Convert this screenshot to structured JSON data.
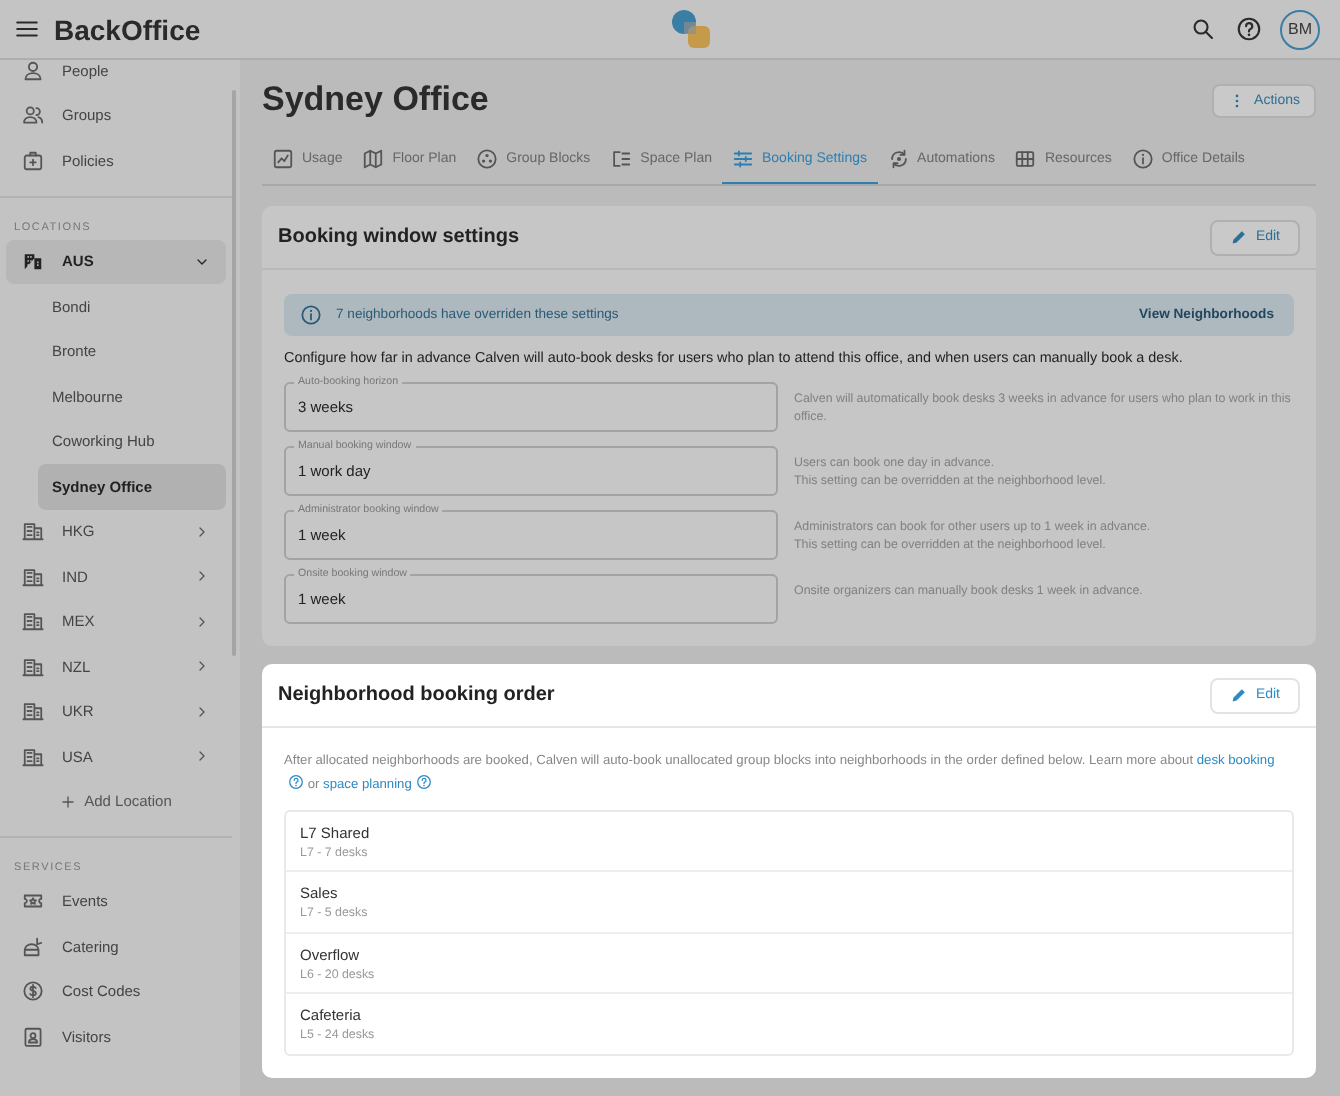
{
  "app": {
    "title": "BackOffice",
    "avatar": "BM"
  },
  "sidebar": {
    "top_items": [
      {
        "label": "People"
      },
      {
        "label": "Groups"
      },
      {
        "label": "Policies"
      }
    ],
    "locations_heading": "LOCATIONS",
    "locations": [
      {
        "label": "AUS",
        "expanded": true,
        "children": [
          {
            "label": "Bondi",
            "selected": false
          },
          {
            "label": "Bronte",
            "selected": false
          },
          {
            "label": "Melbourne",
            "selected": false
          },
          {
            "label": "Coworking Hub",
            "selected": false
          },
          {
            "label": "Sydney Office",
            "selected": true
          }
        ]
      },
      {
        "label": "HKG",
        "expanded": false
      },
      {
        "label": "IND",
        "expanded": false
      },
      {
        "label": "MEX",
        "expanded": false
      },
      {
        "label": "NZL",
        "expanded": false
      },
      {
        "label": "UKR",
        "expanded": false
      },
      {
        "label": "USA",
        "expanded": false
      }
    ],
    "add_location": "Add Location",
    "services_heading": "SERVICES",
    "services": [
      {
        "label": "Events"
      },
      {
        "label": "Catering"
      },
      {
        "label": "Cost Codes"
      },
      {
        "label": "Visitors"
      }
    ]
  },
  "page": {
    "title": "Sydney Office",
    "actions": "Actions",
    "tabs": [
      {
        "label": "Usage",
        "selected": false
      },
      {
        "label": "Floor Plan",
        "selected": false
      },
      {
        "label": "Group Blocks",
        "selected": false
      },
      {
        "label": "Space Plan",
        "selected": false
      },
      {
        "label": "Booking Settings",
        "selected": true
      },
      {
        "label": "Automations",
        "selected": false
      },
      {
        "label": "Resources",
        "selected": false
      },
      {
        "label": "Office Details",
        "selected": false
      }
    ],
    "booking_window": {
      "title": "Booking window settings",
      "edit": "Edit",
      "focused": false,
      "banner": {
        "text": "7 neighborhoods have overriden these settings",
        "link": "View Neighborhoods"
      },
      "description": "Configure how far in advance Calven will auto-book desks for users who plan to attend this office, and when users can manually book a desk.",
      "fields": [
        {
          "label": "Auto-booking horizon",
          "value": "3 weeks",
          "help": [
            "Calven will automatically book desks 3 weeks in advance for users who plan to work in this office."
          ]
        },
        {
          "label": "Manual booking window",
          "value": "1 work day",
          "help": [
            "Users can book one day in advance.",
            "This setting can be overridden at the neighborhood level."
          ]
        },
        {
          "label": "Administrator booking window",
          "value": "1 week",
          "help": [
            "Administrators can book for other users up to 1 week in advance.",
            "This setting can be overridden at the neighborhood level."
          ]
        },
        {
          "label": "Onsite booking window",
          "value": "1 week",
          "help": [
            "Onsite organizers can manually book desks 1 week in advance."
          ]
        }
      ]
    },
    "booking_order": {
      "title": "Neighborhood booking order",
      "edit": "Edit",
      "focused": true,
      "description": "After allocated neighborhoods are booked, Calven will auto-book unallocated group blocks into neighborhoods in the order defined below. Learn more about",
      "link_1": "desk booking",
      "joiner": "or",
      "link_2": "space planning",
      "neighborhoods": [
        {
          "name": "L7 Shared",
          "detail": "L7 - 7 desks"
        },
        {
          "name": "Sales",
          "detail": "L7 - 5 desks"
        },
        {
          "name": "Overflow",
          "detail": "L6 - 20 desks"
        },
        {
          "name": "Cafeteria",
          "detail": "L5 - 24 desks"
        }
      ]
    }
  }
}
